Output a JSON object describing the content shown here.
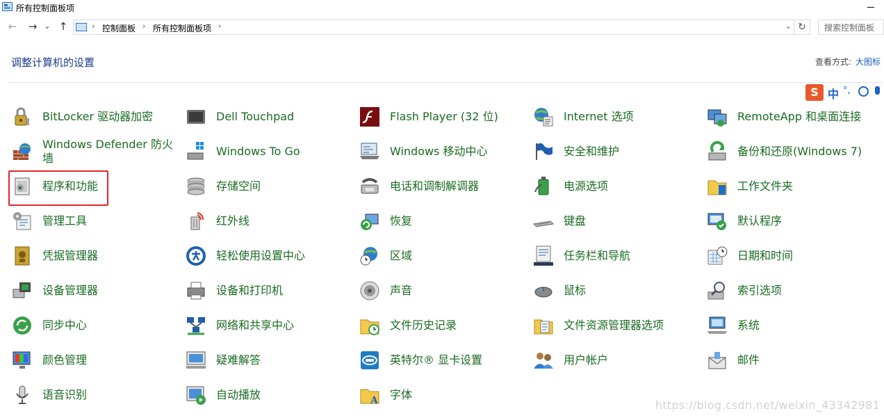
{
  "window": {
    "title": "所有控制面板项"
  },
  "navigation": {
    "back": "←",
    "forward": "→",
    "recent": "⌄",
    "up": "↑"
  },
  "address": {
    "crumbs": [
      "控制面板",
      "所有控制面板项"
    ],
    "separator": "›",
    "dropdown": "⌄",
    "refresh": "↻"
  },
  "search": {
    "placeholder": "搜索控制面板"
  },
  "header": {
    "title": "调整计算机的设置",
    "view_label": "查看方式:",
    "view_value": "大图标"
  },
  "ime": {
    "logo": "S",
    "mode": "中",
    "punct": "°,",
    "smile": "☺",
    "mic": "🎤"
  },
  "items": [
    {
      "label": "BitLocker 驱动器加密",
      "icon": "bitlocker-icon"
    },
    {
      "label": "Dell Touchpad",
      "icon": "touchpad-icon"
    },
    {
      "label": "Flash Player (32 位)",
      "icon": "flash-icon"
    },
    {
      "label": "Internet 选项",
      "icon": "internet-options-icon"
    },
    {
      "label": "RemoteApp 和桌面连接",
      "icon": "remoteapp-icon"
    },
    {
      "label": "Windows Defender 防火墙",
      "icon": "firewall-icon"
    },
    {
      "label": "Windows To Go",
      "icon": "windows-to-go-icon"
    },
    {
      "label": "Windows 移动中心",
      "icon": "mobility-center-icon"
    },
    {
      "label": "安全和维护",
      "icon": "security-flag-icon"
    },
    {
      "label": "备份和还原(Windows 7)",
      "icon": "backup-icon"
    },
    {
      "label": "程序和功能",
      "icon": "programs-features-icon"
    },
    {
      "label": "存储空间",
      "icon": "storage-spaces-icon"
    },
    {
      "label": "电话和调制解调器",
      "icon": "phone-modem-icon"
    },
    {
      "label": "电源选项",
      "icon": "power-options-icon"
    },
    {
      "label": "工作文件夹",
      "icon": "work-folders-icon"
    },
    {
      "label": "管理工具",
      "icon": "admin-tools-icon"
    },
    {
      "label": "红外线",
      "icon": "infrared-icon"
    },
    {
      "label": "恢复",
      "icon": "recovery-icon"
    },
    {
      "label": "键盘",
      "icon": "keyboard-icon"
    },
    {
      "label": "默认程序",
      "icon": "default-programs-icon"
    },
    {
      "label": "凭据管理器",
      "icon": "credential-manager-icon"
    },
    {
      "label": "轻松使用设置中心",
      "icon": "ease-of-access-icon"
    },
    {
      "label": "区域",
      "icon": "region-icon"
    },
    {
      "label": "任务栏和导航",
      "icon": "taskbar-icon"
    },
    {
      "label": "日期和时间",
      "icon": "date-time-icon"
    },
    {
      "label": "设备管理器",
      "icon": "device-manager-icon"
    },
    {
      "label": "设备和打印机",
      "icon": "printer-icon"
    },
    {
      "label": "声音",
      "icon": "sound-icon"
    },
    {
      "label": "鼠标",
      "icon": "mouse-icon"
    },
    {
      "label": "索引选项",
      "icon": "indexing-icon"
    },
    {
      "label": "同步中心",
      "icon": "sync-center-icon"
    },
    {
      "label": "网络和共享中心",
      "icon": "network-sharing-icon"
    },
    {
      "label": "文件历史记录",
      "icon": "file-history-icon"
    },
    {
      "label": "文件资源管理器选项",
      "icon": "folder-options-icon"
    },
    {
      "label": "系统",
      "icon": "system-icon"
    },
    {
      "label": "颜色管理",
      "icon": "color-management-icon"
    },
    {
      "label": "疑难解答",
      "icon": "troubleshooting-icon"
    },
    {
      "label": "英特尔® 显卡设置",
      "icon": "intel-graphics-icon"
    },
    {
      "label": "用户帐户",
      "icon": "user-accounts-icon"
    },
    {
      "label": "邮件",
      "icon": "mail-icon"
    },
    {
      "label": "语音识别",
      "icon": "speech-recognition-icon"
    },
    {
      "label": "自动播放",
      "icon": "autoplay-icon"
    },
    {
      "label": "字体",
      "icon": "fonts-icon"
    }
  ],
  "watermark": "https://blog.csdn.net/weixin_43342981"
}
